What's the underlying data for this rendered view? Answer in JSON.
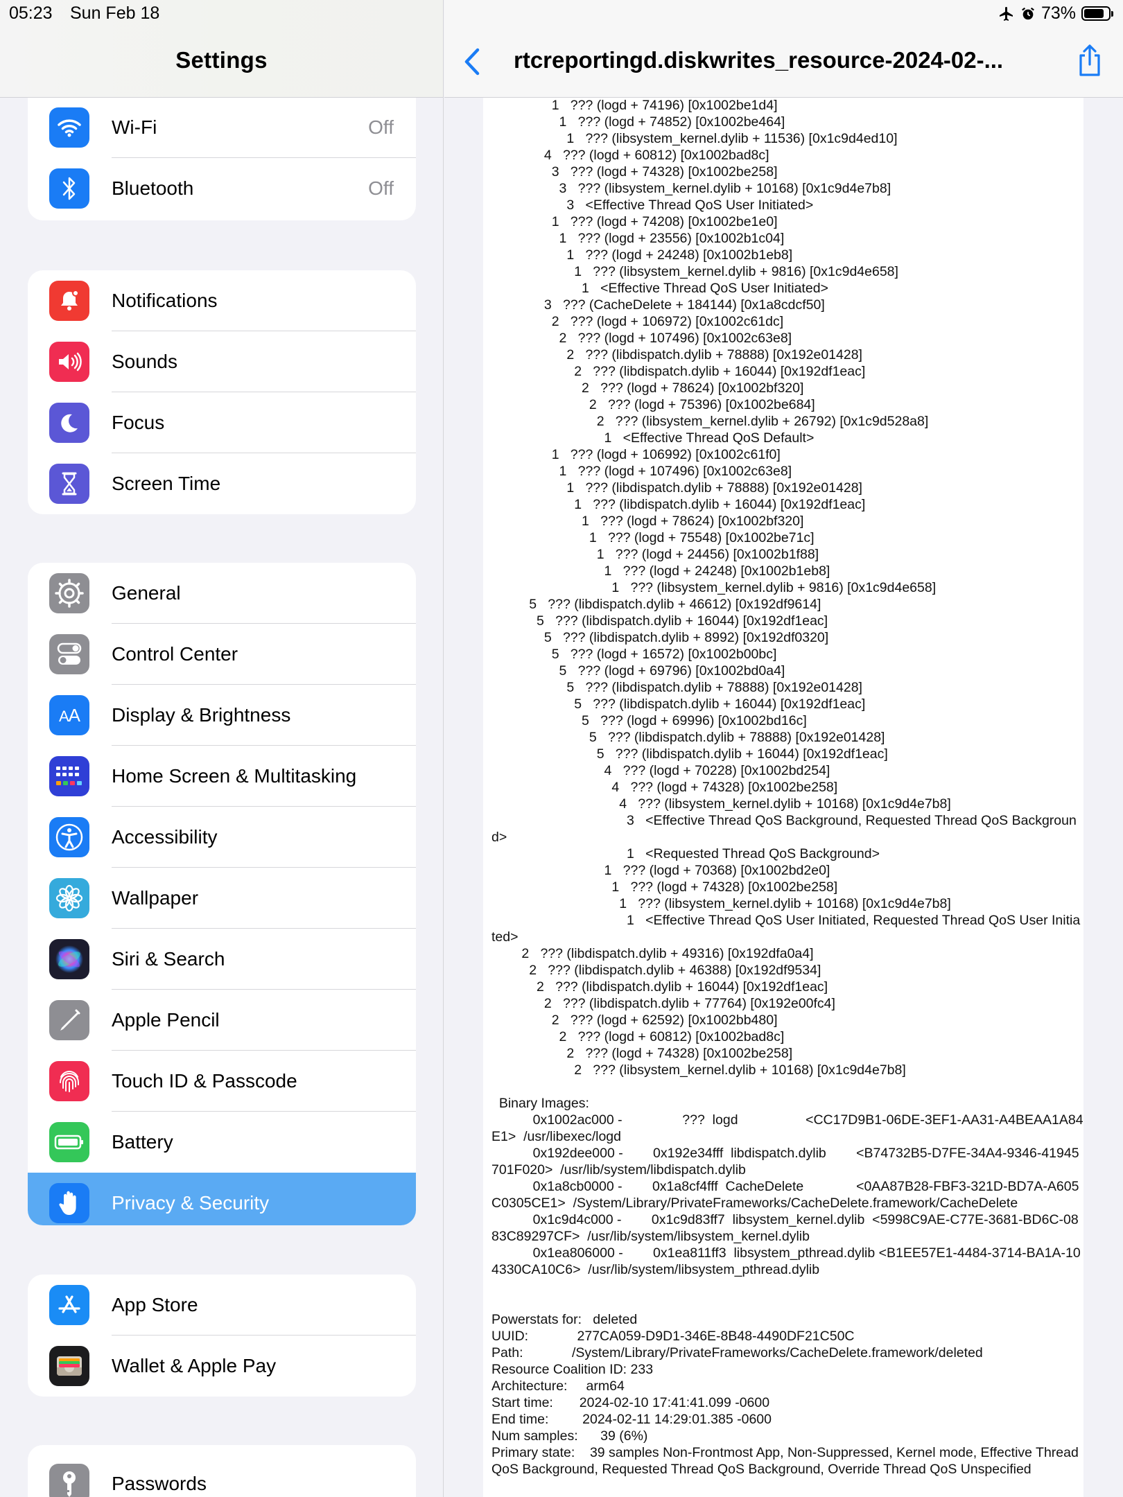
{
  "status_bar": {
    "time": "05:23",
    "date": "Sun Feb 18",
    "battery_percent": "73%",
    "battery_level": 0.73
  },
  "sidebar": {
    "title": "Settings",
    "groups": [
      {
        "items": [
          {
            "label": "Wi-Fi",
            "value": "Off",
            "icon": "wifi-icon",
            "color": "#1a7cf5"
          },
          {
            "label": "Bluetooth",
            "value": "Off",
            "icon": "bluetooth-icon",
            "color": "#1a7cf5"
          }
        ]
      },
      {
        "items": [
          {
            "label": "Notifications",
            "icon": "bell-icon",
            "color": "#f03a32"
          },
          {
            "label": "Sounds",
            "icon": "speaker-icon",
            "color": "#f02d52"
          },
          {
            "label": "Focus",
            "icon": "moon-icon",
            "color": "#5b57d6"
          },
          {
            "label": "Screen Time",
            "icon": "hourglass-icon",
            "color": "#5b57d6"
          }
        ]
      },
      {
        "items": [
          {
            "label": "General",
            "icon": "gear-icon",
            "color": "#8e8e93"
          },
          {
            "label": "Control Center",
            "icon": "toggles-icon",
            "color": "#8e8e93"
          },
          {
            "label": "Display & Brightness",
            "icon": "text-size-icon",
            "color": "#1a7cf5"
          },
          {
            "label": "Home Screen & Multitasking",
            "icon": "app-grid-icon",
            "color": "#2f3fd6"
          },
          {
            "label": "Accessibility",
            "icon": "accessibility-icon",
            "color": "#1a7cf5"
          },
          {
            "label": "Wallpaper",
            "icon": "flower-icon",
            "color": "#35aadc"
          },
          {
            "label": "Siri & Search",
            "icon": "siri-icon",
            "color": "#1c1c2e"
          },
          {
            "label": "Apple Pencil",
            "icon": "pencil-icon",
            "color": "#8e8e93"
          },
          {
            "label": "Touch ID & Passcode",
            "icon": "fingerprint-icon",
            "color": "#f02d52"
          },
          {
            "label": "Battery",
            "icon": "battery-icon",
            "color": "#34c759"
          },
          {
            "label": "Privacy & Security",
            "icon": "hand-icon",
            "color": "#1a7cf5",
            "selected": true
          }
        ]
      },
      {
        "items": [
          {
            "label": "App Store",
            "icon": "app-store-icon",
            "color": "#1a8cf5"
          },
          {
            "label": "Wallet & Apple Pay",
            "icon": "wallet-icon",
            "color": "#1c1c1e"
          }
        ]
      },
      {
        "items": [
          {
            "label": "Passwords",
            "icon": "key-icon",
            "color": "#8e8e93"
          }
        ]
      }
    ]
  },
  "detail": {
    "title": "rtcreportingd.diskwrites_resource-2024-02-...",
    "report_lines": [
      "                1   ??? (logd + 74196) [0x1002be1d4]",
      "                  1   ??? (logd + 74852) [0x1002be464]",
      "                    1   ??? (libsystem_kernel.dylib + 11536) [0x1c9d4ed10]",
      "              4   ??? (logd + 60812) [0x1002bad8c]",
      "                3   ??? (logd + 74328) [0x1002be258]",
      "                  3   ??? (libsystem_kernel.dylib + 10168) [0x1c9d4e7b8]",
      "                    3   <Effective Thread QoS User Initiated>",
      "                1   ??? (logd + 74208) [0x1002be1e0]",
      "                  1   ??? (logd + 23556) [0x1002b1c04]",
      "                    1   ??? (logd + 24248) [0x1002b1eb8]",
      "                      1   ??? (libsystem_kernel.dylib + 9816) [0x1c9d4e658]",
      "                        1   <Effective Thread QoS User Initiated>",
      "              3   ??? (CacheDelete + 184144) [0x1a8cdcf50]",
      "                2   ??? (logd + 106972) [0x1002c61dc]",
      "                  2   ??? (logd + 107496) [0x1002c63e8]",
      "                    2   ??? (libdispatch.dylib + 78888) [0x192e01428]",
      "                      2   ??? (libdispatch.dylib + 16044) [0x192df1eac]",
      "                        2   ??? (logd + 78624) [0x1002bf320]",
      "                          2   ??? (logd + 75396) [0x1002be684]",
      "                            2   ??? (libsystem_kernel.dylib + 26792) [0x1c9d528a8]",
      "                              1   <Effective Thread QoS Default>",
      "                1   ??? (logd + 106992) [0x1002c61f0]",
      "                  1   ??? (logd + 107496) [0x1002c63e8]",
      "                    1   ??? (libdispatch.dylib + 78888) [0x192e01428]",
      "                      1   ??? (libdispatch.dylib + 16044) [0x192df1eac]",
      "                        1   ??? (logd + 78624) [0x1002bf320]",
      "                          1   ??? (logd + 75548) [0x1002be71c]",
      "                            1   ??? (logd + 24456) [0x1002b1f88]",
      "                              1   ??? (logd + 24248) [0x1002b1eb8]",
      "                                1   ??? (libsystem_kernel.dylib + 9816) [0x1c9d4e658]",
      "          5   ??? (libdispatch.dylib + 46612) [0x192df9614]",
      "            5   ??? (libdispatch.dylib + 16044) [0x192df1eac]",
      "              5   ??? (libdispatch.dylib + 8992) [0x192df0320]",
      "                5   ??? (logd + 16572) [0x1002b00bc]",
      "                  5   ??? (logd + 69796) [0x1002bd0a4]",
      "                    5   ??? (libdispatch.dylib + 78888) [0x192e01428]",
      "                      5   ??? (libdispatch.dylib + 16044) [0x192df1eac]",
      "                        5   ??? (logd + 69996) [0x1002bd16c]",
      "                          5   ??? (libdispatch.dylib + 78888) [0x192e01428]",
      "                            5   ??? (libdispatch.dylib + 16044) [0x192df1eac]",
      "                              4   ??? (logd + 70228) [0x1002bd254]",
      "                                4   ??? (logd + 74328) [0x1002be258]",
      "                                  4   ??? (libsystem_kernel.dylib + 10168) [0x1c9d4e7b8]",
      "                                    3   <Effective Thread QoS Background, Requested Thread QoS Background>",
      "                                    1   <Requested Thread QoS Background>",
      "                              1   ??? (logd + 70368) [0x1002bd2e0]",
      "                                1   ??? (logd + 74328) [0x1002be258]",
      "                                  1   ??? (libsystem_kernel.dylib + 10168) [0x1c9d4e7b8]",
      "                                    1   <Effective Thread QoS User Initiated, Requested Thread QoS User Initiated>",
      "        2   ??? (libdispatch.dylib + 49316) [0x192dfa0a4]",
      "          2   ??? (libdispatch.dylib + 46388) [0x192df9534]",
      "            2   ??? (libdispatch.dylib + 16044) [0x192df1eac]",
      "              2   ??? (libdispatch.dylib + 77764) [0x192e00fc4]",
      "                2   ??? (logd + 62592) [0x1002bb480]",
      "                  2   ??? (logd + 60812) [0x1002bad8c]",
      "                    2   ??? (logd + 74328) [0x1002be258]",
      "                      2   ??? (libsystem_kernel.dylib + 10168) [0x1c9d4e7b8]",
      "",
      "  Binary Images:",
      "           0x1002ac000 -                ???  logd                  <CC17D9B1-06DE-3EF1-AA31-A4BEAA1A84E1>  /usr/libexec/logd",
      "           0x192dee000 -        0x192e34fff  libdispatch.dylib        <B74732B5-D7FE-34A4-9346-41945701F020>  /usr/lib/system/libdispatch.dylib",
      "           0x1a8cb0000 -        0x1a8cf4fff  CacheDelete              <0AA87B28-FBF3-321D-BD7A-A605C0305CE1>  /System/Library/PrivateFrameworks/CacheDelete.framework/CacheDelete",
      "           0x1c9d4c000 -        0x1c9d83ff7  libsystem_kernel.dylib  <5998C9AE-C77E-3681-BD6C-0883C89297CF>  /usr/lib/system/libsystem_kernel.dylib",
      "           0x1ea806000 -        0x1ea811ff3  libsystem_pthread.dylib <B1EE57E1-4484-3714-BA1A-104330CA10C6>  /usr/lib/system/libsystem_pthread.dylib",
      "",
      "",
      "Powerstats for:   deleted",
      "UUID:             277CA059-D9D1-346E-8B48-4490DF21C50C",
      "Path:             /System/Library/PrivateFrameworks/CacheDelete.framework/deleted",
      "Resource Coalition ID: 233",
      "Architecture:     arm64",
      "Start time:       2024-02-10 17:41:41.099 -0600",
      "End time:         2024-02-11 14:29:01.385 -0600",
      "Num samples:      39 (6%)",
      "Primary state:    39 samples Non-Frontmost App, Non-Suppressed, Kernel mode, Effective Thread QoS Background, Requested Thread QoS Background, Override Thread QoS Unspecified"
    ]
  }
}
